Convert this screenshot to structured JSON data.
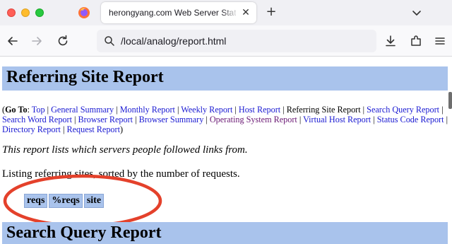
{
  "browser": {
    "tab_title": "herongyang.com Web Server Statist",
    "tab_close": "✕",
    "new_tab": "+",
    "url": "/local/analog/report.html"
  },
  "page": {
    "heading": "Referring Site Report",
    "goto_label": "Go To",
    "goto_links": [
      {
        "label": "Top"
      },
      {
        "label": "General Summary"
      },
      {
        "label": "Monthly Report"
      },
      {
        "label": "Weekly Report"
      },
      {
        "label": "Host Report"
      },
      {
        "label": "Referring Site Report"
      },
      {
        "label": "Search Query Report"
      },
      {
        "label": "Search Word Report"
      },
      {
        "label": "Browser Report"
      },
      {
        "label": "Browser Summary"
      },
      {
        "label": "Operating System Report"
      },
      {
        "label": "Virtual Host Report"
      },
      {
        "label": "Status Code Report"
      },
      {
        "label": "Directory Report"
      },
      {
        "label": "Request Report"
      }
    ],
    "description": "This report lists which servers people followed links from.",
    "listing_text": "Listing referring sites, sorted by the number of requests.",
    "table_headers": [
      "reqs",
      "%reqs",
      "site"
    ],
    "next_heading": "Search Query Report"
  },
  "colors": {
    "header_bg": "#a9c3ec",
    "link": "#1a1ad2",
    "visited_link": "#6b1a75",
    "annotation": "#e4412b"
  },
  "icons": {
    "tab_icon": "firefox-icon",
    "back": "back-arrow-icon",
    "forward": "forward-arrow-icon",
    "reload": "reload-icon",
    "url_search": "search-icon",
    "downloads": "download-icon",
    "extensions": "extensions-icon",
    "menu": "hamburger-menu-icon",
    "tab_list": "chevron-down-icon"
  }
}
